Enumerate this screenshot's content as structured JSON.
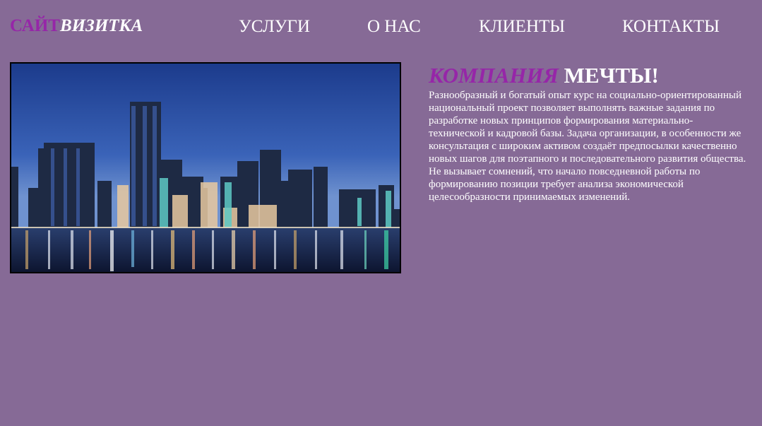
{
  "header": {
    "logo_part1": "САЙТ",
    "logo_part2": "ВИЗИТКА",
    "nav": [
      "УСЛУГИ",
      "О НАС",
      "КЛИЕНТЫ",
      "КОНТАКТЫ"
    ]
  },
  "main": {
    "title_part1": "КОМПАНИЯ",
    "title_part2": "МЕЧТЫ!",
    "text": "Разнообразный и богатый опыт курс на социально-ориентированный национальный проект позволяет выполнять важные задания по разработке новых принципов формирования материально-технической и кадровой базы. Задача организации, в особенности же консультация с широким активом создаёт предпосылки качественно новых шагов для поэтапного и последовательного развития общества. Не вызывает сомнений, что начало повседневной работы по формированию позиции требует анализа экономической целесообразности принимаемых изменений."
  },
  "colors": {
    "background": "#866a96",
    "accent": "#9626a8",
    "text": "#ffffff"
  }
}
